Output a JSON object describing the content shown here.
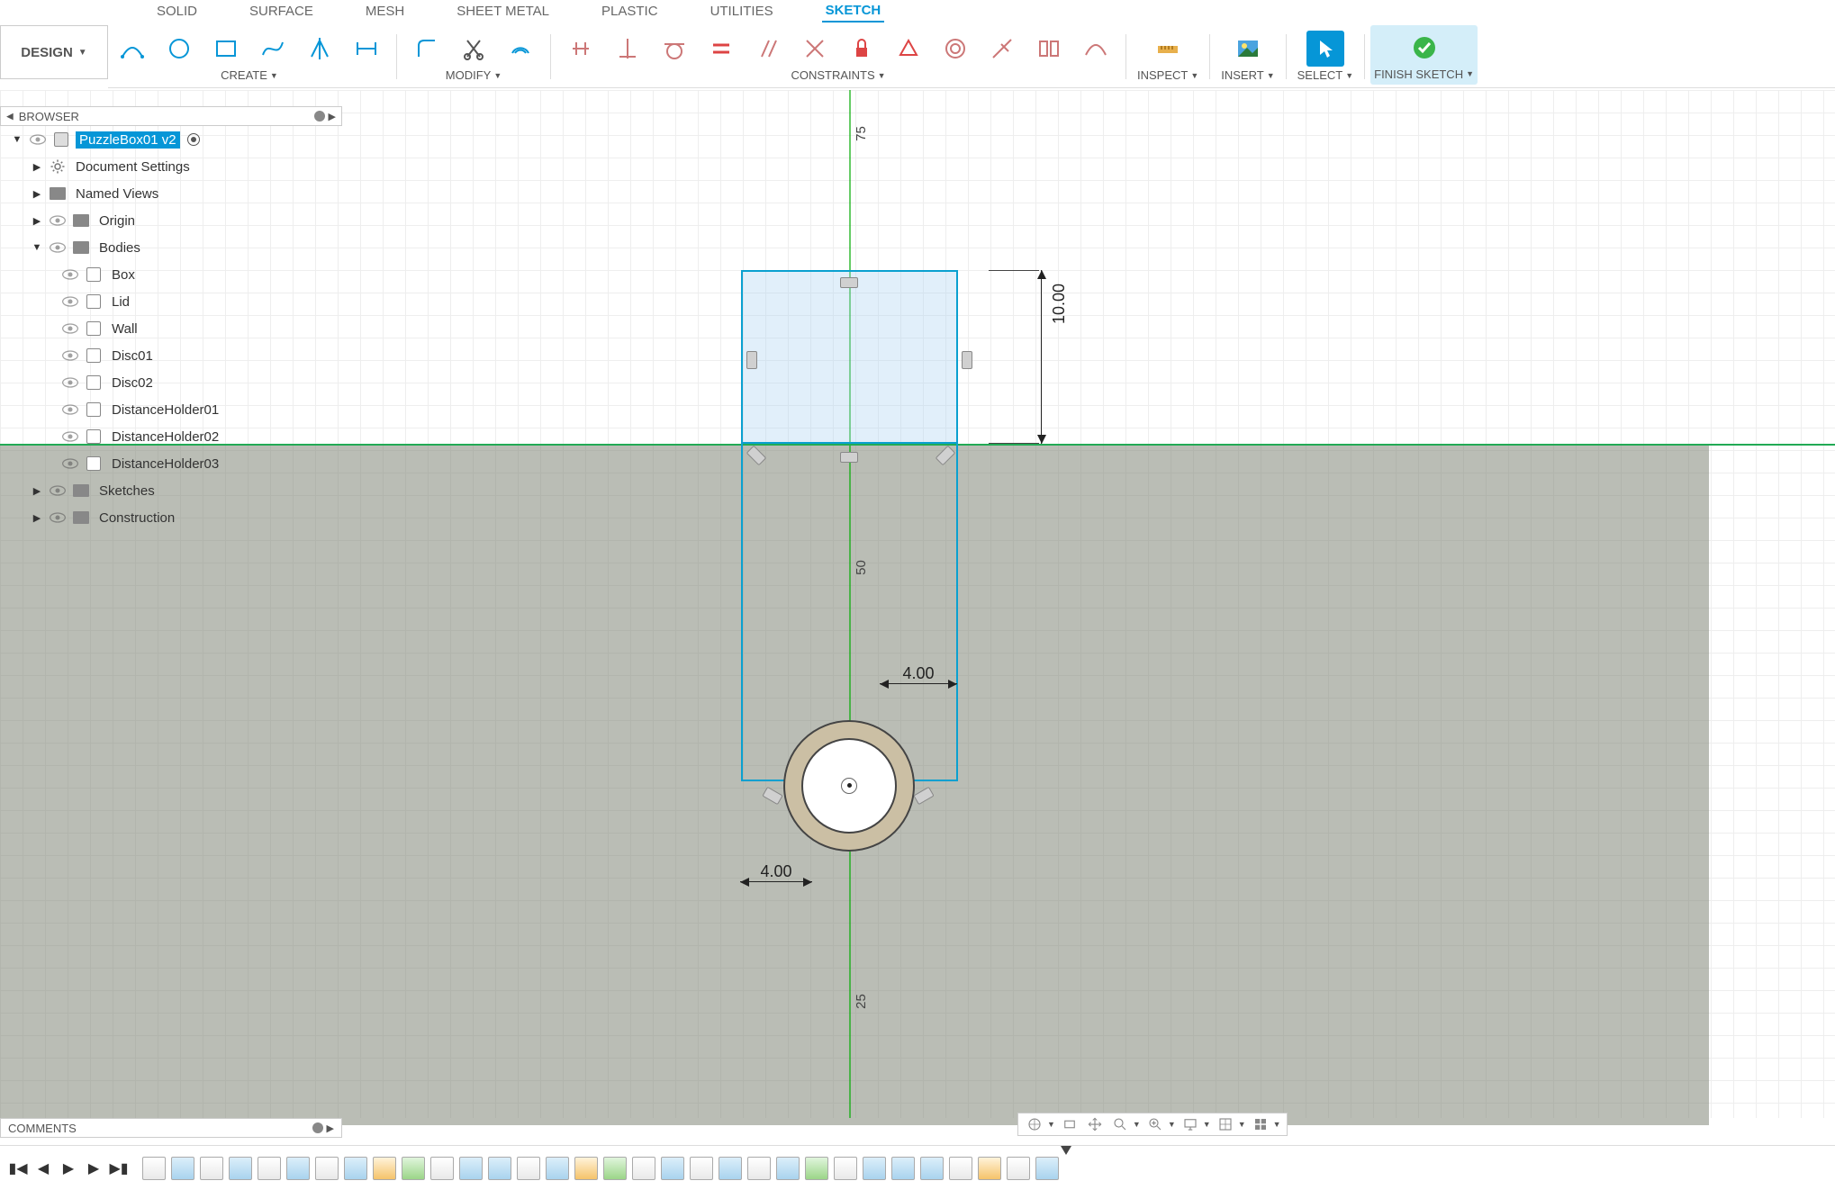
{
  "workspace_label": "DESIGN",
  "tabs": [
    "SOLID",
    "SURFACE",
    "MESH",
    "SHEET METAL",
    "PLASTIC",
    "UTILITIES",
    "SKETCH"
  ],
  "active_tab": "SKETCH",
  "ribbon": {
    "create_label": "CREATE",
    "modify_label": "MODIFY",
    "constraints_label": "CONSTRAINTS",
    "inspect_label": "INSPECT",
    "insert_label": "INSERT",
    "select_label": "SELECT",
    "finish_label": "FINISH SKETCH"
  },
  "browser": {
    "title": "BROWSER",
    "root": "PuzzleBox01 v2",
    "items": [
      "Document Settings",
      "Named Views",
      "Origin",
      "Bodies"
    ],
    "bodies": [
      "Box",
      "Lid",
      "Wall",
      "Disc01",
      "Disc02",
      "DistanceHolder01",
      "DistanceHolder02",
      "DistanceHolder03"
    ],
    "tail": [
      "Sketches",
      "Construction"
    ]
  },
  "sketch": {
    "dim_height": "10.00",
    "dim_upper": "4.00",
    "dim_lower": "4.00",
    "axis_top": "75",
    "axis_mid": "50",
    "axis_bot": "25"
  },
  "comments_label": "COMMENTS",
  "timeline_count": 32
}
